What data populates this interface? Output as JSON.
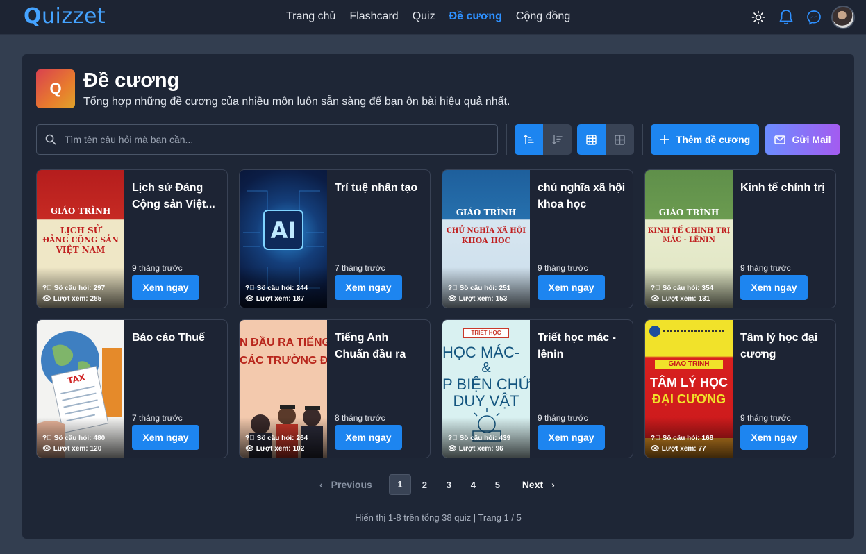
{
  "app": {
    "logo_q": "Q",
    "logo_rest": "uizzet"
  },
  "nav": {
    "links": [
      "Trang chủ",
      "Flashcard",
      "Quiz",
      "Đề cương",
      "Cộng đồng"
    ],
    "active_index": 3
  },
  "icons": {
    "theme": "sun-icon",
    "notifications": "bell-icon",
    "messenger": "messenger-icon"
  },
  "header": {
    "icon_letter": "Q",
    "title": "Đề cương",
    "subtitle": "Tổng hợp những đề cương của nhiều môn luôn sẵn sàng để bạn ôn bài hiệu quả nhất."
  },
  "search": {
    "placeholder": "Tìm tên câu hỏi mà bạn cần...",
    "value": ""
  },
  "toolbar": {
    "add_label": "Thêm đề cương",
    "mail_label": "Gửi Mail"
  },
  "labels": {
    "questions": "Số câu hỏi: ",
    "views": "Lượt xem: ",
    "view_button": "Xem ngay"
  },
  "cards": [
    {
      "title": "Lịch sử Đảng Cộng sản Việt...",
      "time": "9 tháng trước",
      "questions": 297,
      "views": 285,
      "cover": "red",
      "cover_text": {
        "top": "GIÁO TRÌNH",
        "line1": "LỊCH SỬ",
        "line2": "ĐẢNG CỘNG SẢN",
        "line3": "VIỆT NAM"
      }
    },
    {
      "title": "Trí tuệ nhân tạo",
      "time": "7 tháng trước",
      "questions": 244,
      "views": 187,
      "cover": "ai",
      "cover_text": {
        "main": "AI"
      }
    },
    {
      "title": "chủ nghĩa xã hội khoa học",
      "time": "9 tháng trước",
      "questions": 251,
      "views": 153,
      "cover": "blue",
      "cover_text": {
        "top": "GIÁO TRÌNH",
        "line1": "CHỦ NGHĨA XÃ HỘI",
        "line2": "KHOA HỌC"
      }
    },
    {
      "title": "Kinh tế chính trị",
      "time": "9 tháng trước",
      "questions": 354,
      "views": 131,
      "cover": "green",
      "cover_text": {
        "top": "GIÁO TRÌNH",
        "line1": "KINH TẾ CHÍNH TRỊ",
        "line2": "MÁC - LÊNIN"
      }
    },
    {
      "title": "Báo cáo Thuế",
      "time": "7 tháng trước",
      "questions": 480,
      "views": 120,
      "cover": "tax",
      "cover_text": {
        "main": "TAX"
      }
    },
    {
      "title": "Tiếng Anh Chuẩn đầu ra",
      "time": "8 tháng trước",
      "questions": 264,
      "views": 102,
      "cover": "english",
      "cover_text": {
        "line1": "N ĐẦU RA TIẾNG",
        "line2": "CÁC TRƯỜNG ĐẠ"
      }
    },
    {
      "title": "Triết học mác - lênin",
      "time": "9 tháng trước",
      "questions": 439,
      "views": 96,
      "cover": "philo",
      "cover_text": {
        "top": "TRIẾT HỌC",
        "line1": "HỌC MÁC-",
        "line2": "&",
        "line3": "P BIỆN CHỨ",
        "line4": "DUY VẬT"
      }
    },
    {
      "title": "Tâm lý học đại cương",
      "time": "9 tháng trước",
      "questions": 168,
      "views": 77,
      "cover": "psych",
      "cover_text": {
        "top": "GIÁO TRÌNH",
        "line1": "TÂM LÝ HỌC",
        "line2": "ĐẠI CƯƠNG"
      }
    }
  ],
  "pagination": {
    "prev_label": "Previous",
    "next_label": "Next",
    "pages": [
      "1",
      "2",
      "3",
      "4",
      "5"
    ],
    "current": "1",
    "summary": "Hiển thị 1-8 trên tổng 38 quiz | Trang 1 / 5"
  }
}
